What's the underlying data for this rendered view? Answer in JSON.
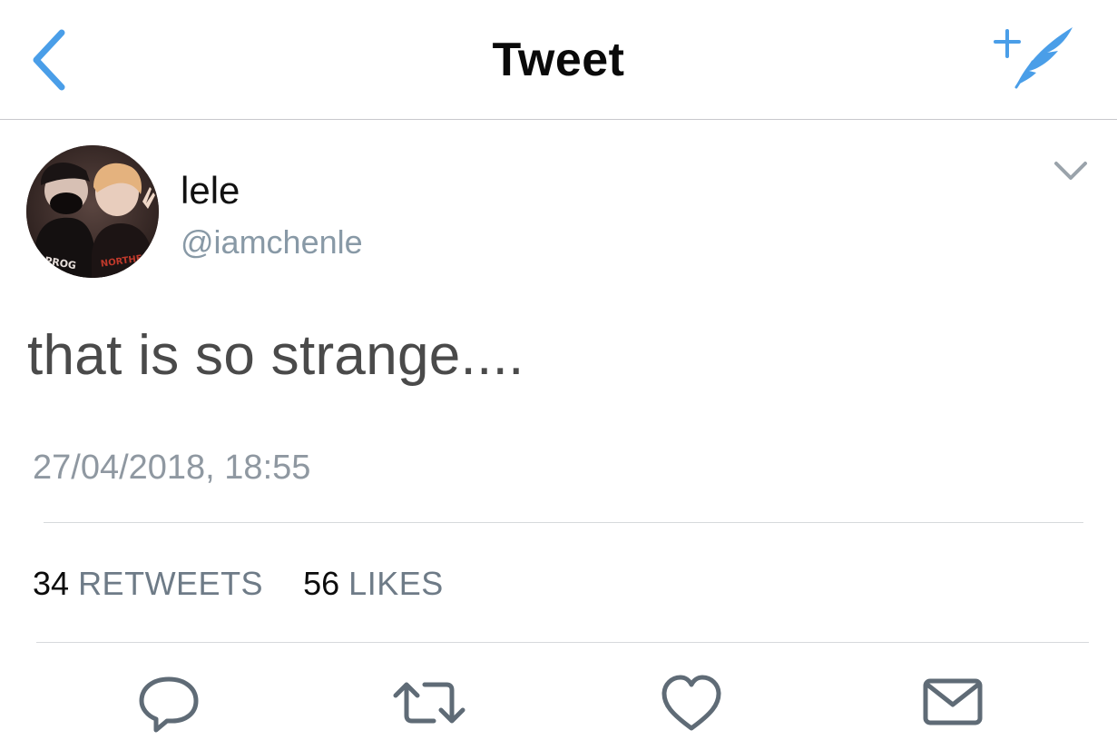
{
  "nav": {
    "title": "Tweet",
    "back_icon": "chevron-left-icon",
    "compose_icon": "compose-tweet-icon"
  },
  "tweet": {
    "display_name": "lele",
    "username": "@iamchenle",
    "text": "that is so strange....",
    "timestamp": "27/04/2018, 18:55",
    "stats": {
      "retweets_count": "34",
      "retweets_label": "RETWEETS",
      "likes_count": "56",
      "likes_label": "LIKES"
    },
    "avatar_text": {
      "shirt_left": "PROG",
      "shirt_right": "NORTHE"
    }
  },
  "actions": [
    {
      "name": "reply",
      "icon": "reply-icon"
    },
    {
      "name": "retweet",
      "icon": "retweet-icon"
    },
    {
      "name": "like",
      "icon": "heart-icon"
    },
    {
      "name": "direct-message",
      "icon": "envelope-icon"
    }
  ],
  "colors": {
    "accent": "#4a9ee8",
    "secondary_text": "#8899a6",
    "icon_gray": "#5f6b76"
  }
}
